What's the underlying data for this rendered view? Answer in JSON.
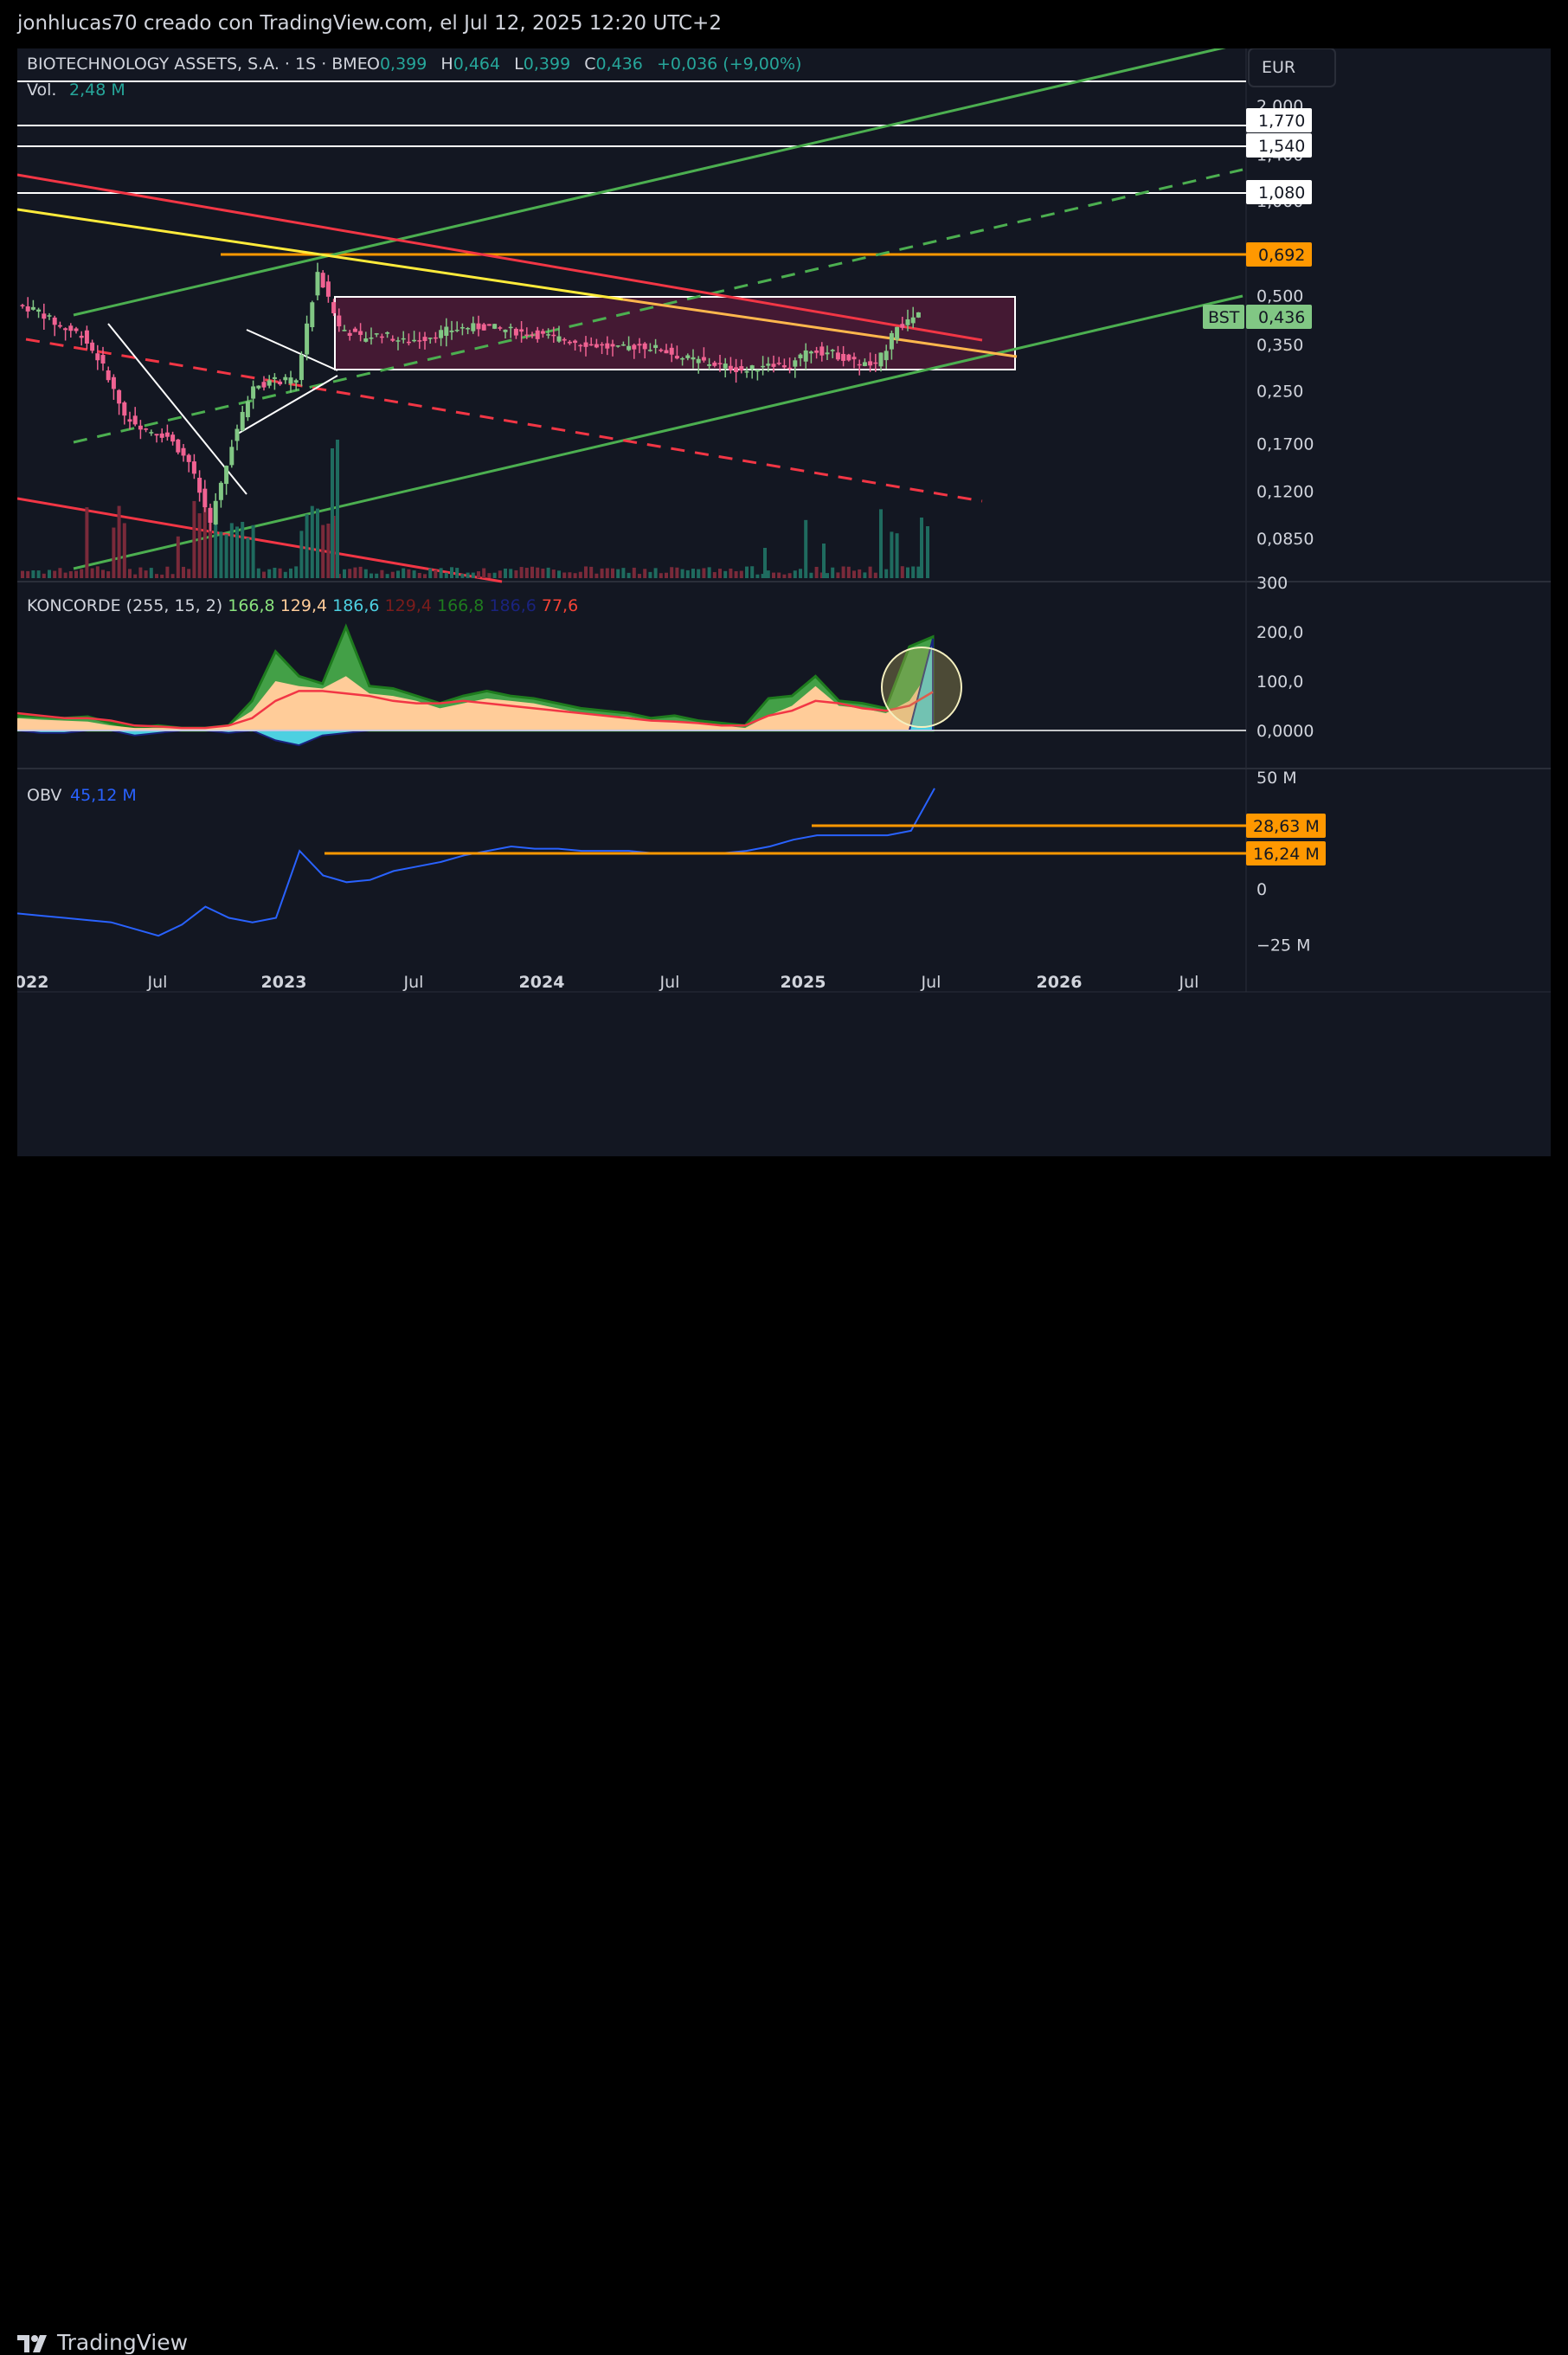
{
  "header": {
    "caption": "jonhlucas70 creado con TradingView.com, el Jul 12, 2025 12:20 UTC+2"
  },
  "legend": {
    "symbol": "BIOTECHNOLOGY ASSETS, S.A. · 1S · BME",
    "o_label": "O",
    "o_value": "0,399",
    "h_label": "H",
    "h_value": "0,464",
    "l_label": "L",
    "l_value": "0,399",
    "c_label": "C",
    "c_value": "0,436",
    "change": "+0,036 (+9,00%)",
    "vol_label": "Vol.",
    "vol_value": "2,48 M"
  },
  "currency": "EUR",
  "ticker_tag": "BST",
  "price_scale": {
    "ticks": [
      "2,000",
      "1,400",
      "1,000",
      "0,500",
      "0,350",
      "0,250",
      "0,1700",
      "0,1200",
      "0,0850"
    ],
    "labels": [
      {
        "text": "1,770",
        "kind": "white"
      },
      {
        "text": "1,540",
        "kind": "white"
      },
      {
        "text": "1,080",
        "kind": "white"
      },
      {
        "text": "0,692",
        "kind": "orange"
      },
      {
        "text": "0,436",
        "kind": "green"
      }
    ]
  },
  "koncorde": {
    "title": "KONCORDE (255, 15, 2)",
    "values": [
      {
        "text": "166,8",
        "color": "#89e27d"
      },
      {
        "text": "129,4",
        "color": "#ffcc99"
      },
      {
        "text": "186,6",
        "color": "#4dd0e1"
      },
      {
        "text": "129,4",
        "color": "#7a1c1c"
      },
      {
        "text": "166,8",
        "color": "#1e7b1e"
      },
      {
        "text": "186,6",
        "color": "#1a237e"
      },
      {
        "text": "77,6",
        "color": "#f44336"
      }
    ],
    "scale": [
      "300",
      "200,0",
      "100,0",
      "0,0000"
    ]
  },
  "obv": {
    "title": "OBV",
    "value": "45,12 M",
    "scale": [
      "50 M",
      "0",
      "−25 M"
    ],
    "labels": [
      "28,63 M",
      "16,24 M"
    ]
  },
  "time_axis": [
    "2022",
    "Jul",
    "2023",
    "Jul",
    "2024",
    "Jul",
    "2025",
    "Jul",
    "2026",
    "Jul"
  ],
  "brand": {
    "name": "TradingView"
  },
  "colors": {
    "background": "#131722",
    "up": "#81c784",
    "down": "#f06292",
    "orange": "#ff9800",
    "green_channel": "#4caf50",
    "red_line": "#f23645",
    "yellow_line": "#ffeb3b",
    "obv_line": "#2962ff",
    "range_box": "#4a1a35"
  },
  "chart_data": [
    {
      "type": "candlestick",
      "title": "BIOTECHNOLOGY ASSETS, S.A. · 1S · BME",
      "x_range": [
        "2022-01",
        "2026-11"
      ],
      "yscale": "log",
      "ylim": [
        0.07,
        2.2
      ],
      "y_ticks": [
        2.0,
        1.4,
        1.0,
        0.5,
        0.35,
        0.25,
        0.17,
        0.12,
        0.085
      ],
      "grid": false,
      "points": [
        {
          "x": "2022-01",
          "close": 0.47
        },
        {
          "x": "2022-02",
          "close": 0.45
        },
        {
          "x": "2022-03",
          "close": 0.4
        },
        {
          "x": "2022-04",
          "close": 0.38
        },
        {
          "x": "2022-05",
          "close": 0.3
        },
        {
          "x": "2022-06",
          "close": 0.21
        },
        {
          "x": "2022-07",
          "close": 0.19
        },
        {
          "x": "2022-08",
          "close": 0.18
        },
        {
          "x": "2022-09",
          "close": 0.15
        },
        {
          "x": "2022-10",
          "close": 0.095
        },
        {
          "x": "2022-11",
          "close": 0.17
        },
        {
          "x": "2022-12",
          "close": 0.26
        },
        {
          "x": "2023-01",
          "close": 0.27
        },
        {
          "x": "2023-02",
          "close": 0.27
        },
        {
          "x": "2023-03",
          "close": 0.6
        },
        {
          "x": "2023-04",
          "close": 0.4
        },
        {
          "x": "2023-05",
          "close": 0.37
        },
        {
          "x": "2023-06",
          "close": 0.38
        },
        {
          "x": "2023-07",
          "close": 0.36
        },
        {
          "x": "2023-08",
          "close": 0.37
        },
        {
          "x": "2023-09",
          "close": 0.39
        },
        {
          "x": "2023-10",
          "close": 0.4
        },
        {
          "x": "2023-11",
          "close": 0.4
        },
        {
          "x": "2023-12",
          "close": 0.39
        },
        {
          "x": "2024-01",
          "close": 0.38
        },
        {
          "x": "2024-02",
          "close": 0.37
        },
        {
          "x": "2024-03",
          "close": 0.36
        },
        {
          "x": "2024-04",
          "close": 0.35
        },
        {
          "x": "2024-05",
          "close": 0.34
        },
        {
          "x": "2024-06",
          "close": 0.35
        },
        {
          "x": "2024-07",
          "close": 0.34
        },
        {
          "x": "2024-08",
          "close": 0.32
        },
        {
          "x": "2024-09",
          "close": 0.31
        },
        {
          "x": "2024-10",
          "close": 0.3
        },
        {
          "x": "2024-11",
          "close": 0.29
        },
        {
          "x": "2024-12",
          "close": 0.31
        },
        {
          "x": "2025-01",
          "close": 0.3
        },
        {
          "x": "2025-02",
          "close": 0.34
        },
        {
          "x": "2025-03",
          "close": 0.33
        },
        {
          "x": "2025-04",
          "close": 0.31
        },
        {
          "x": "2025-05",
          "close": 0.3
        },
        {
          "x": "2025-06",
          "close": 0.4
        },
        {
          "x": "2025-07",
          "close": 0.436
        }
      ],
      "horizontal_levels": [
        1.77,
        1.54,
        1.08,
        0.692
      ],
      "range_box": {
        "x": [
          "2023-03",
          "2025-12"
        ],
        "y": [
          0.29,
          0.5
        ]
      }
    },
    {
      "type": "area",
      "title": "KONCORDE (255, 15, 2)",
      "ylim": [
        -30,
        300
      ],
      "y_ticks": [
        300,
        200,
        100,
        0
      ],
      "grid": false,
      "series": [
        {
          "values": [
            30,
            28,
            25,
            28,
            15,
            5,
            10,
            5,
            5,
            10,
            60,
            160,
            110,
            95,
            210,
            90,
            85,
            70,
            55,
            70,
            80,
            70,
            65,
            55,
            45,
            40,
            35,
            25,
            30,
            20,
            15,
            10,
            65,
            70,
            110,
            60,
            55,
            45,
            170,
            190
          ]
        },
        {
          "values": [
            25,
            22,
            20,
            18,
            10,
            5,
            5,
            5,
            5,
            10,
            40,
            100,
            90,
            85,
            110,
            75,
            70,
            60,
            45,
            55,
            65,
            60,
            55,
            45,
            35,
            30,
            28,
            20,
            20,
            15,
            10,
            5,
            30,
            50,
            90,
            50,
            45,
            35,
            60,
            130
          ]
        },
        {
          "values": [
            0,
            -5,
            -5,
            0,
            0,
            -10,
            -5,
            0,
            0,
            -5,
            0,
            -20,
            -30,
            -10,
            -5,
            0,
            0,
            0,
            0,
            0,
            0,
            0,
            0,
            0,
            0,
            0,
            0,
            0,
            0,
            0,
            0,
            0,
            0,
            0,
            0,
            0,
            0,
            0,
            0,
            186
          ]
        },
        {
          "values": [
            35,
            30,
            25,
            25,
            20,
            10,
            8,
            5,
            5,
            10,
            25,
            60,
            80,
            80,
            75,
            70,
            60,
            55,
            55,
            60,
            55,
            50,
            45,
            40,
            35,
            30,
            25,
            20,
            18,
            15,
            10,
            10,
            30,
            40,
            60,
            55,
            45,
            40,
            50,
            78
          ]
        }
      ]
    },
    {
      "type": "line",
      "title": "OBV",
      "ylim": [
        -30,
        55
      ],
      "y_ticks": [
        50,
        0,
        -25
      ],
      "grid": false,
      "series": [
        {
          "values": [
            -11,
            -12,
            -13,
            -14,
            -15,
            -18,
            -21,
            -16,
            -8,
            -13,
            -15,
            -13,
            17,
            6,
            3,
            4,
            8,
            10,
            12,
            15,
            17,
            19,
            18,
            18,
            17,
            17,
            17,
            16,
            16,
            16,
            16,
            17,
            19,
            22,
            24,
            24,
            24,
            24,
            26,
            45
          ]
        }
      ],
      "horizontal_levels": [
        28.63,
        16.24
      ]
    }
  ]
}
